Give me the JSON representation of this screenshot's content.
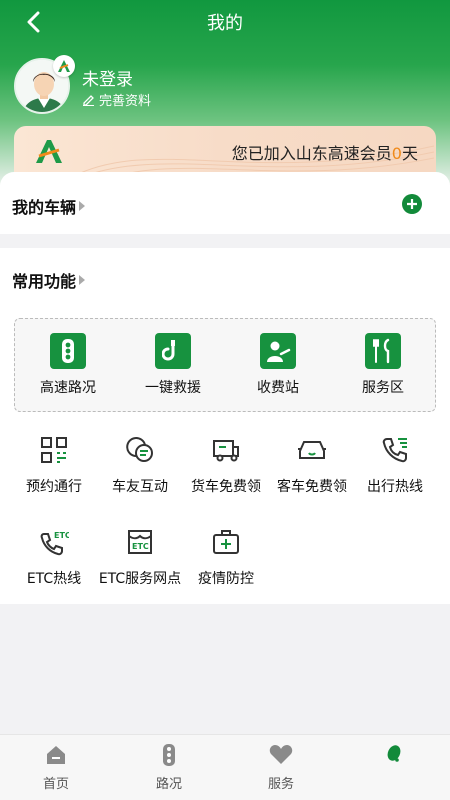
{
  "header": {
    "title": "我的"
  },
  "profile": {
    "name": "未登录",
    "edit_label": "完善资料"
  },
  "member": {
    "prefix": "您已加入山东高速会员",
    "days": "0",
    "suffix": "天"
  },
  "vehicles": {
    "title": "我的车辆"
  },
  "functions": {
    "title": "常用功能",
    "featured": [
      {
        "label": "高速路况",
        "icon": "traffic-light-icon"
      },
      {
        "label": "一键救援",
        "icon": "hook-icon"
      },
      {
        "label": "收费站",
        "icon": "toll-staff-icon"
      },
      {
        "label": "服务区",
        "icon": "fork-knife-icon"
      }
    ],
    "items": [
      {
        "label": "预约通行",
        "icon": "qr-code-icon"
      },
      {
        "label": "车友互动",
        "icon": "chat-icon"
      },
      {
        "label": "货车免费领",
        "icon": "truck-icon"
      },
      {
        "label": "客车免费领",
        "icon": "car-icon"
      },
      {
        "label": "出行热线",
        "icon": "phone-icon"
      },
      {
        "label": "ETC热线",
        "icon": "etc-phone-icon"
      },
      {
        "label": "ETC服务网点",
        "icon": "etc-store-icon"
      },
      {
        "label": "疫情防控",
        "icon": "medical-kit-icon"
      }
    ]
  },
  "tabbar": {
    "tabs": [
      {
        "label": "首页",
        "icon": "home-icon"
      },
      {
        "label": "路况",
        "icon": "traffic-icon"
      },
      {
        "label": "服务",
        "icon": "heart-icon"
      },
      {
        "label": "",
        "icon": "profile-leaf-icon"
      }
    ]
  },
  "colors": {
    "brand_green": "#128a3a",
    "accent_orange": "#f08a1a"
  }
}
